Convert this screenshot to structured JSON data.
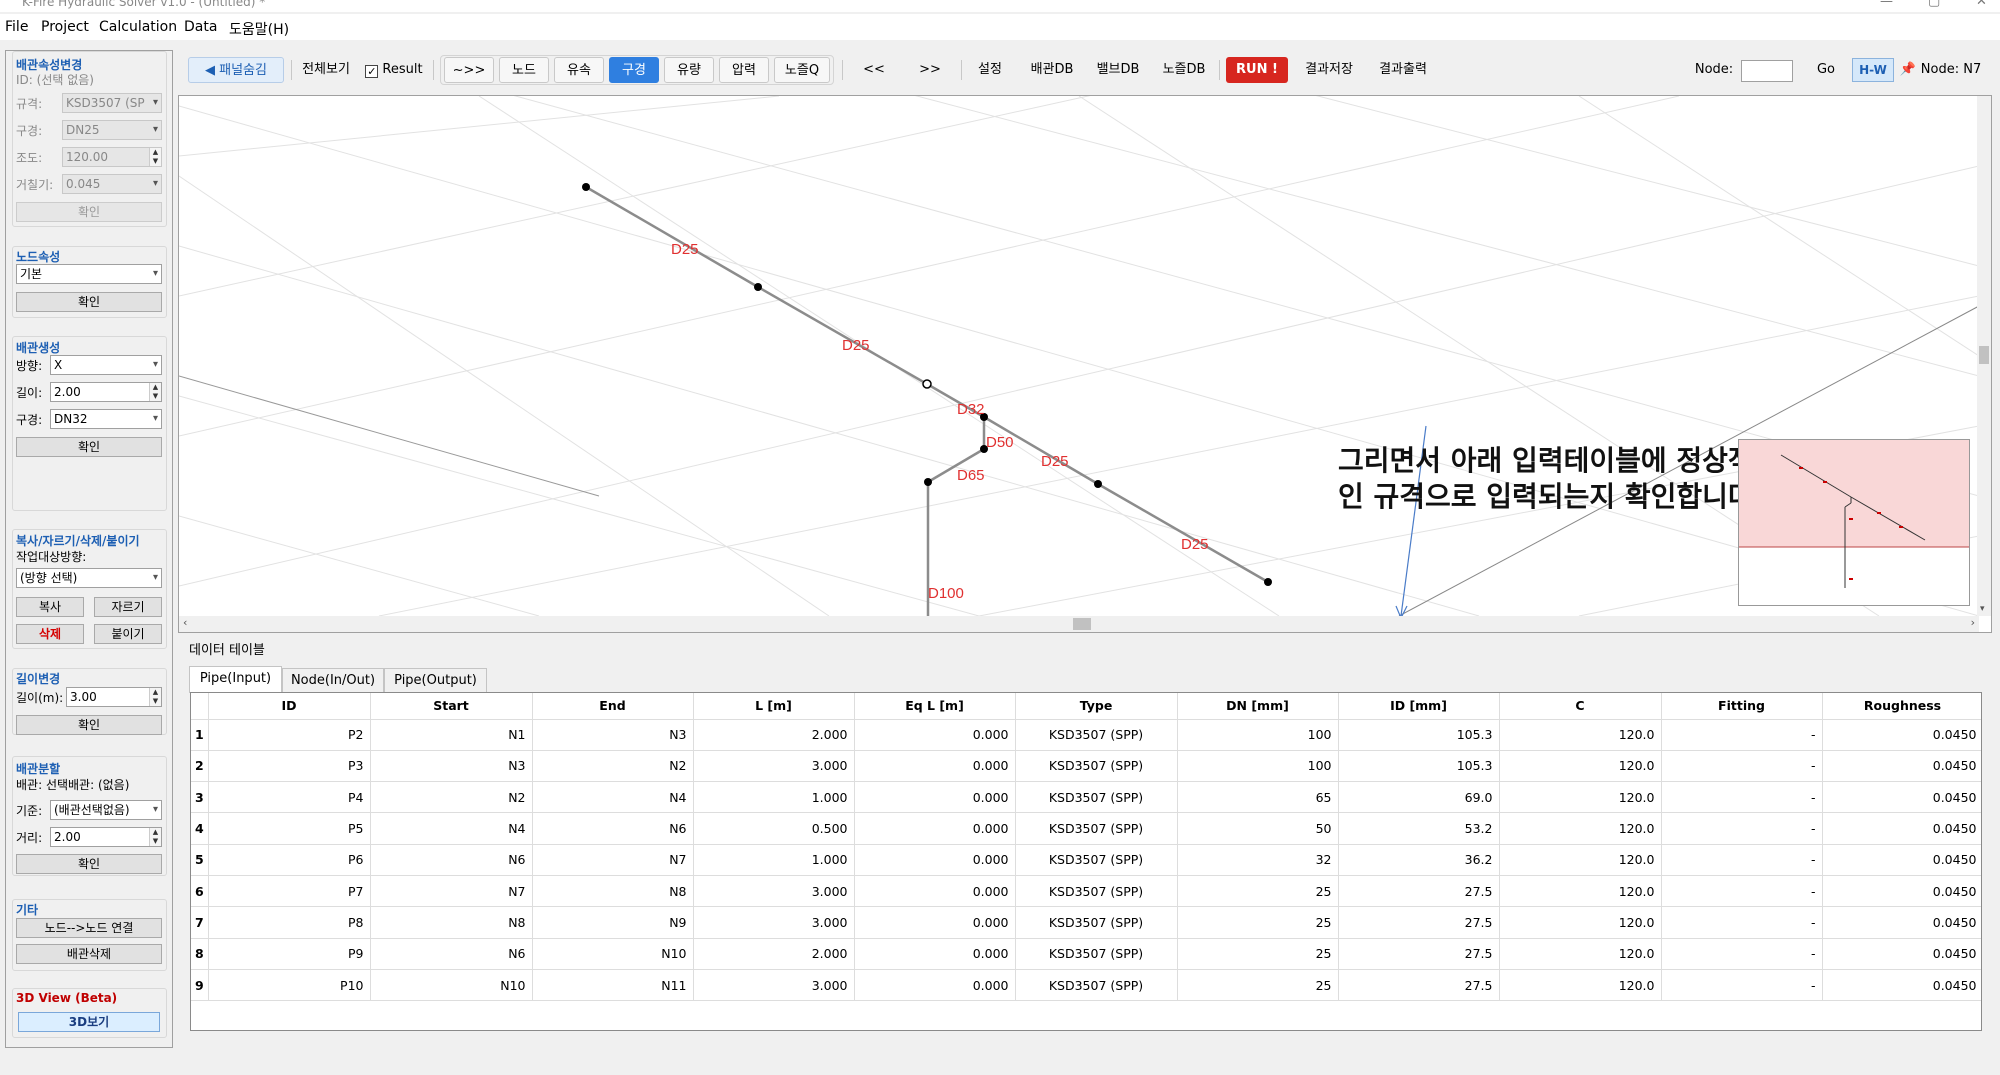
{
  "window": {
    "title": "K-Fire Hydraulic Solver v1.0 - (Untitled) *"
  },
  "menu": [
    "File",
    "Project",
    "Calculation",
    "Data",
    "도움말(H)"
  ],
  "left_panel": {
    "pipe_props": {
      "title": "배관속성변경",
      "id_line": "ID: (선택 없음)",
      "spec_label": "규격:",
      "spec_value": "KSD3507 (SP",
      "dia_label": "구경:",
      "dia_value": "DN25",
      "c_label": "조도:",
      "c_value": "120.00",
      "rough_label": "거칠기:",
      "rough_value": "0.045",
      "confirm": "확인"
    },
    "node_props": {
      "title": "노드속성",
      "value": "기본",
      "confirm": "확인"
    },
    "pipe_create": {
      "title": "배관생성",
      "dir_label": "방향:",
      "dir_value": "X",
      "len_label": "길이:",
      "len_value": "2.00",
      "dia_label": "구경:",
      "dia_value": "DN32",
      "confirm": "확인"
    },
    "copy_cut": {
      "title": "복사/자르기/삭제/붙이기",
      "target_label": "작업대상방향:",
      "dir_value": "(방향 선택)",
      "copy": "복사",
      "cut": "자르기",
      "delete": "삭제",
      "paste": "붙이기"
    },
    "length_change": {
      "title": "길이변경",
      "label": "길이(m):",
      "value": "3.00",
      "confirm": "확인"
    },
    "pipe_split": {
      "title": "배관분할",
      "pipe_line": "배관: 선택배관: (없음)",
      "base_label": "기준:",
      "base_value": "(배관선택없음)",
      "dist_label": "거리:",
      "dist_value": "2.00",
      "confirm": "확인"
    },
    "etc": {
      "title": "기타",
      "connect": "노드-->노드 연결",
      "delete_pipe": "배관삭제"
    },
    "view3d": {
      "title": "3D View (Beta)",
      "button": "3D보기"
    }
  },
  "toolbar": {
    "panel_hide": "◀ 패널숨김",
    "view_all": "전체보기",
    "result": "Result",
    "modes": [
      "~>>",
      "노드",
      "유속",
      "구경",
      "유량",
      "압력",
      "노즐Q"
    ],
    "active_mode": "구경",
    "prev": "<<",
    "next": ">>",
    "settings": "설정",
    "pipe_db": "배관DB",
    "valve_db": "밸브DB",
    "nozzle_db": "노즐DB",
    "run": "RUN !",
    "save_result": "결과저장",
    "print_result": "결과출력",
    "node_label": "Node:",
    "node_input": "",
    "go": "Go",
    "hw": "H-W",
    "node_status": "Node: N7"
  },
  "viewport": {
    "labels": [
      "D25",
      "D25",
      "D32",
      "D50",
      "D65",
      "D25",
      "D25",
      "D100"
    ],
    "annotation_line1": "그리면서 아래 입력테이블에 정상적",
    "annotation_line2": "인 규격으로 입력되는지 확인합니다"
  },
  "data_table": {
    "title": "데이터 테이블",
    "tabs": [
      "Pipe(Input)",
      "Node(In/Out)",
      "Pipe(Output)"
    ],
    "active_tab": "Pipe(Input)",
    "headers": [
      "",
      "ID",
      "Start",
      "End",
      "L [m]",
      "Eq L [m]",
      "Type",
      "DN [mm]",
      "ID [mm]",
      "C",
      "Fitting",
      "Roughness"
    ],
    "rows": [
      [
        "1",
        "P2",
        "N1",
        "N3",
        "2.000",
        "0.000",
        "KSD3507 (SPP)",
        "100",
        "105.3",
        "120.0",
        "-",
        "0.0450"
      ],
      [
        "2",
        "P3",
        "N3",
        "N2",
        "3.000",
        "0.000",
        "KSD3507 (SPP)",
        "100",
        "105.3",
        "120.0",
        "-",
        "0.0450"
      ],
      [
        "3",
        "P4",
        "N2",
        "N4",
        "1.000",
        "0.000",
        "KSD3507 (SPP)",
        "65",
        "69.0",
        "120.0",
        "-",
        "0.0450"
      ],
      [
        "4",
        "P5",
        "N4",
        "N6",
        "0.500",
        "0.000",
        "KSD3507 (SPP)",
        "50",
        "53.2",
        "120.0",
        "-",
        "0.0450"
      ],
      [
        "5",
        "P6",
        "N6",
        "N7",
        "1.000",
        "0.000",
        "KSD3507 (SPP)",
        "32",
        "36.2",
        "120.0",
        "-",
        "0.0450"
      ],
      [
        "6",
        "P7",
        "N7",
        "N8",
        "3.000",
        "0.000",
        "KSD3507 (SPP)",
        "25",
        "27.5",
        "120.0",
        "-",
        "0.0450"
      ],
      [
        "7",
        "P8",
        "N8",
        "N9",
        "3.000",
        "0.000",
        "KSD3507 (SPP)",
        "25",
        "27.5",
        "120.0",
        "-",
        "0.0450"
      ],
      [
        "8",
        "P9",
        "N6",
        "N10",
        "2.000",
        "0.000",
        "KSD3507 (SPP)",
        "25",
        "27.5",
        "120.0",
        "-",
        "0.0450"
      ],
      [
        "9",
        "P10",
        "N10",
        "N11",
        "3.000",
        "0.000",
        "KSD3507 (SPP)",
        "25",
        "27.5",
        "120.0",
        "-",
        "0.0450"
      ]
    ]
  }
}
